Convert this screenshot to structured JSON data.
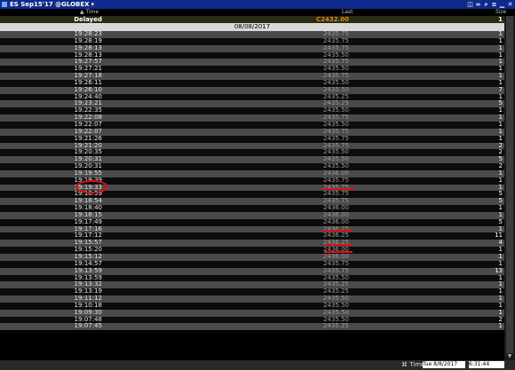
{
  "window": {
    "title": "ES Sep15'17 @GLOBEX"
  },
  "columns": {
    "time": "Time",
    "last": "Last",
    "size": "Size"
  },
  "delayed_row": {
    "label": "Delayed",
    "last": "C2432.00",
    "size": "1"
  },
  "date_divider": "08/08/2017",
  "rows": [
    {
      "time": "19:28:23",
      "last": "2435.75",
      "size": "1"
    },
    {
      "time": "19:28:19",
      "last": "2435.75",
      "size": "1"
    },
    {
      "time": "19:28:13",
      "last": "2435.75",
      "size": "1"
    },
    {
      "time": "19:28:13",
      "last": "2435.50",
      "size": "1"
    },
    {
      "time": "19:27:57",
      "last": "2435.75",
      "size": "1"
    },
    {
      "time": "19:27:21",
      "last": "2435.50",
      "size": "1"
    },
    {
      "time": "19:27:18",
      "last": "2435.75",
      "size": "1"
    },
    {
      "time": "19:26:11",
      "last": "2435.50",
      "size": "1"
    },
    {
      "time": "19:26:10",
      "last": "2435.50",
      "size": "7"
    },
    {
      "time": "19:24:40",
      "last": "2435.25",
      "size": "1"
    },
    {
      "time": "19:23:21",
      "last": "2435.25",
      "size": "5"
    },
    {
      "time": "19:22:35",
      "last": "2435.50",
      "size": "1"
    },
    {
      "time": "19:22:08",
      "last": "2435.75",
      "size": "1"
    },
    {
      "time": "19:22:07",
      "last": "2435.50",
      "size": "1"
    },
    {
      "time": "19:22:07",
      "last": "2435.75",
      "size": "1"
    },
    {
      "time": "19:21:26",
      "last": "2435.75",
      "size": "1"
    },
    {
      "time": "19:21:20",
      "last": "2435.75",
      "size": "2"
    },
    {
      "time": "19:20:35",
      "last": "2435.50",
      "size": "2"
    },
    {
      "time": "19:20:31",
      "last": "2435.50",
      "size": "5"
    },
    {
      "time": "19:20:31",
      "last": "2435.50",
      "size": "2"
    },
    {
      "time": "19:19:55",
      "last": "2436.00",
      "size": "1"
    },
    {
      "time": "19:19:39",
      "last": "2435.75",
      "size": "1"
    },
    {
      "time": "19:19:33",
      "last": "2435.75",
      "size": "1"
    },
    {
      "time": "19:18:59",
      "last": "2435.75",
      "size": "5"
    },
    {
      "time": "19:18:54",
      "last": "2435.75",
      "size": "5"
    },
    {
      "time": "19:18:40",
      "last": "2436.00",
      "size": "1"
    },
    {
      "time": "19:18:15",
      "last": "2436.00",
      "size": "1"
    },
    {
      "time": "19:17:49",
      "last": "2436.00",
      "size": "5"
    },
    {
      "time": "19:17:16",
      "last": "2436.25",
      "size": "1"
    },
    {
      "time": "19:17:12",
      "last": "2436.25",
      "size": "11"
    },
    {
      "time": "19:15:57",
      "last": "2436.25",
      "size": "4"
    },
    {
      "time": "19:15:20",
      "last": "2436.00",
      "size": "1"
    },
    {
      "time": "19:15:12",
      "last": "2436.00",
      "size": "1"
    },
    {
      "time": "19:14:57",
      "last": "2435.75",
      "size": "1"
    },
    {
      "time": "19:13:59",
      "last": "2435.75",
      "size": "13"
    },
    {
      "time": "19:13:59",
      "last": "2435.50",
      "size": "1"
    },
    {
      "time": "19:13:32",
      "last": "2435.25",
      "size": "1"
    },
    {
      "time": "19:13:19",
      "last": "2435.25",
      "size": "1"
    },
    {
      "time": "19:11:12",
      "last": "2435.50",
      "size": "1"
    },
    {
      "time": "19:10:18",
      "last": "2435.50",
      "size": "1"
    },
    {
      "time": "19:09:30",
      "last": "2435.50",
      "size": "1"
    },
    {
      "time": "19:07:48",
      "last": "2435.50",
      "size": "2"
    },
    {
      "time": "19:07:45",
      "last": "2435.25",
      "size": "1"
    }
  ],
  "footer": {
    "label": "Time",
    "date": "Tue 8/8/2017",
    "time": "6:31:44"
  },
  "colors": {
    "titlebar": "#0f2a8c",
    "delayed_last": "#d98a1a",
    "annotation": "#dd1111"
  },
  "icons": [
    "lock-icon",
    "link-icon",
    "search-icon",
    "settings-icon",
    "minimize-icon",
    "close-icon"
  ]
}
